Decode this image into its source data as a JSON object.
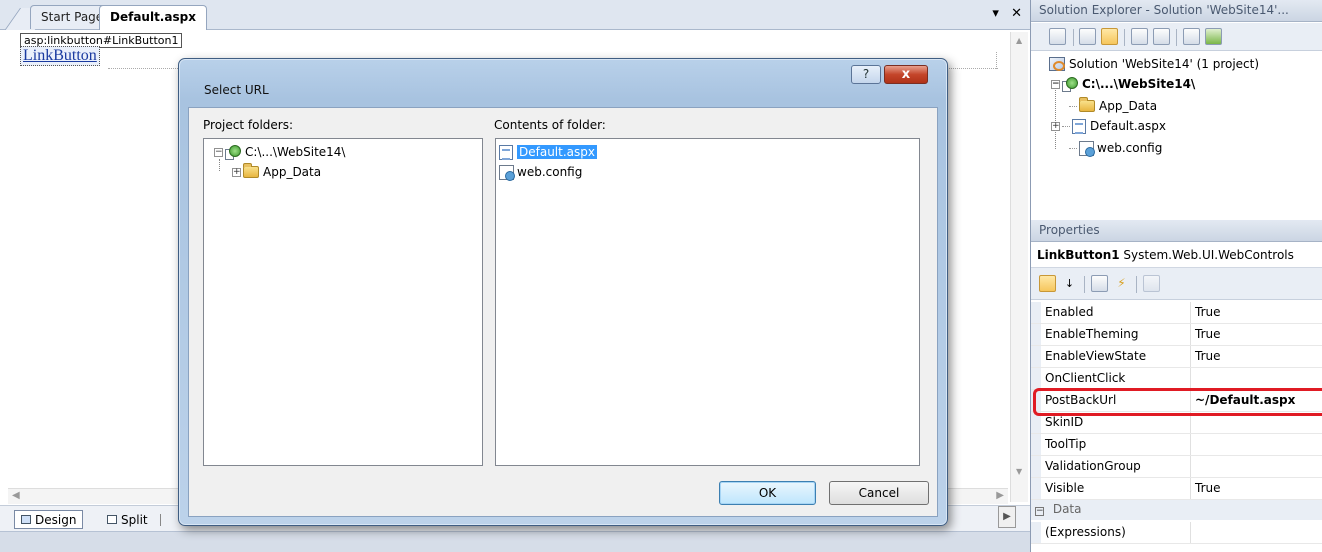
{
  "tabs": [
    {
      "label": "Start Page",
      "active": false
    },
    {
      "label": "Default.aspx",
      "active": true
    }
  ],
  "tab_controls": {
    "dropdown_glyph": "▾",
    "close_glyph": "✕"
  },
  "designer": {
    "tag_tooltip": "asp:linkbutton#LinkButton1",
    "link_button_text": "LinkButton"
  },
  "view_bar": {
    "design_label": "Design",
    "split_label": "Split"
  },
  "dialog": {
    "title": "Select URL",
    "help_glyph": "?",
    "close_glyph": "x",
    "project_folders_label": "Project folders:",
    "contents_label": "Contents of folder:",
    "project_tree": [
      {
        "label": "C:\\...\\WebSite14\\",
        "expander": "−",
        "icon": "web-project-icon"
      },
      {
        "label": "App_Data",
        "expander": "+",
        "icon": "folder-icon"
      }
    ],
    "contents": [
      {
        "label": "Default.aspx",
        "icon": "aspx-file-icon",
        "selected": true
      },
      {
        "label": "web.config",
        "icon": "config-file-icon",
        "selected": false
      }
    ],
    "ok_label": "OK",
    "cancel_label": "Cancel"
  },
  "solution_explorer": {
    "header": "Solution Explorer - Solution 'WebSite14'...",
    "tree": [
      {
        "label": "Solution 'WebSite14' (1 project)",
        "icon": "solution-icon"
      },
      {
        "label": "C:\\...\\WebSite14\\",
        "icon": "web-project-icon",
        "expander": "−",
        "bold": true
      },
      {
        "label": "App_Data",
        "icon": "folder-icon"
      },
      {
        "label": "Default.aspx",
        "icon": "aspx-file-icon",
        "expander": "+"
      },
      {
        "label": "web.config",
        "icon": "config-file-icon"
      }
    ]
  },
  "properties": {
    "header": "Properties",
    "object_name": "LinkButton1",
    "object_type": "System.Web.UI.WebControls",
    "rows": [
      {
        "name": "Enabled",
        "value": "True"
      },
      {
        "name": "EnableTheming",
        "value": "True"
      },
      {
        "name": "EnableViewState",
        "value": "True"
      },
      {
        "name": "OnClientClick",
        "value": ""
      },
      {
        "name": "PostBackUrl",
        "value": "~/Default.aspx",
        "bold": true,
        "highlighted": true
      },
      {
        "name": "SkinID",
        "value": ""
      },
      {
        "name": "ToolTip",
        "value": ""
      },
      {
        "name": "ValidationGroup",
        "value": ""
      },
      {
        "name": "Visible",
        "value": "True"
      }
    ],
    "category": {
      "toggle": "−",
      "label": "Data"
    },
    "expressions_row": {
      "name": "(Expressions)",
      "value": ""
    }
  },
  "colors": {
    "highlight": "#e01b24",
    "selection": "#3399ff",
    "link": "#1a3aa0"
  }
}
